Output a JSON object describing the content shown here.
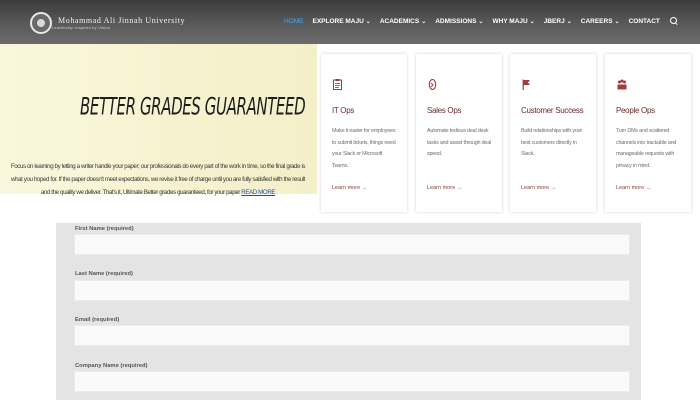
{
  "header": {
    "logo_name": "Mohammad Ali Jinnah University",
    "logo_tagline": "Leadership Inspired by Vision"
  },
  "nav": [
    {
      "label": "HOME",
      "dropdown": false,
      "active": true
    },
    {
      "label": "EXPLORE MAJU",
      "dropdown": true,
      "active": false
    },
    {
      "label": "ACADEMICS",
      "dropdown": true,
      "active": false
    },
    {
      "label": "ADMISSIONS",
      "dropdown": true,
      "active": false
    },
    {
      "label": "WHY MAJU",
      "dropdown": true,
      "active": false
    },
    {
      "label": "JBERJ",
      "dropdown": true,
      "active": false
    },
    {
      "label": "CAREERS",
      "dropdown": true,
      "active": false
    },
    {
      "label": "CONTACT",
      "dropdown": false,
      "active": false
    }
  ],
  "hero": {
    "title": "BETTER GRADES GUARANTEED",
    "paragraph": "Focus on learning by letting a writer handle your paper; our professionals do every part of the work in time, so the final grade is what you hoped for. If the paper doesn't meet expectations, we revise it free of charge until you are fully satisfied with the result and the quality we deliver.",
    "paragraph_tail": "That's it, Ultimate Better grades guaranteed, for your paper ",
    "link_text": "READ MORE"
  },
  "cards": [
    {
      "icon": "clipboard-icon",
      "title": "IT Ops",
      "description": "Make it easier for employees to submit tickets, things need your Slack or Microsoft Teams.",
      "link": "Learn more →"
    },
    {
      "icon": "rocket-icon",
      "title": "Sales Ops",
      "description": "Automate tedious deal desk tasks and assist through deal speed.",
      "link": "Learn more →"
    },
    {
      "icon": "flag-icon",
      "title": "Customer Success",
      "description": "Build relationships with your best customers directly in Slack.",
      "link": "Learn more →"
    },
    {
      "icon": "people-icon",
      "title": "People Ops",
      "description": "Turn DMs and scattered channels into trackable and manageable requests with privacy in mind.",
      "link": "Learn more →"
    }
  ],
  "form": {
    "fields": [
      {
        "label": "First Name (required)",
        "value": ""
      },
      {
        "label": "Last Name (required)",
        "value": ""
      },
      {
        "label": "Email (required)",
        "value": ""
      },
      {
        "label": "Company Name (required)",
        "value": ""
      }
    ]
  },
  "colors": {
    "accent": "#4aa3e8",
    "card_icon": "#a23b3b",
    "card_title": "#6a2a2a"
  }
}
